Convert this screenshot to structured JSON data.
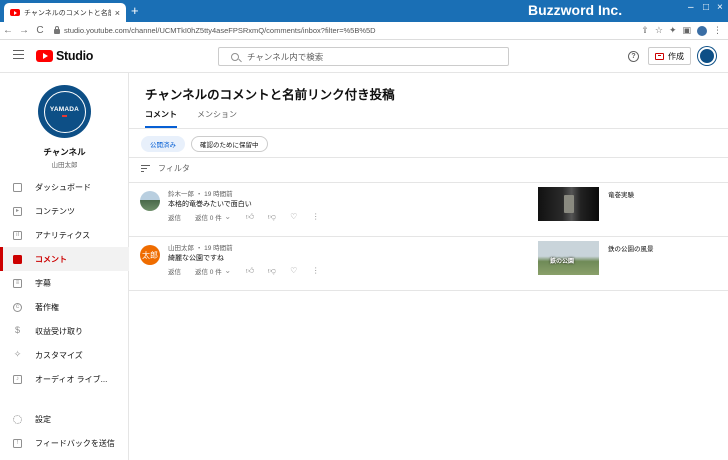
{
  "browser": {
    "tab_title": "チャンネルのコメントと名前リンク付き",
    "new_tab": "+",
    "url": "studio.youtube.com/channel/UCMTkI0hZ5tty4aseFPSRxmQ/comments/inbox?filter=%5B%5D",
    "brand": "Buzzword Inc.",
    "back": "←",
    "forward": "→",
    "reload": "C"
  },
  "header": {
    "logo_text": "Studio",
    "search_placeholder": "チャンネル内で検索",
    "help": "?",
    "create_label": "作成"
  },
  "channel": {
    "avatar_text": "YAMADA",
    "title": "チャンネル",
    "name": "山田太郎"
  },
  "nav": {
    "items": [
      {
        "label": "ダッシュボード",
        "icon": "dashboard-icon"
      },
      {
        "label": "コンテンツ",
        "icon": "content-icon"
      },
      {
        "label": "アナリティクス",
        "icon": "analytics-icon"
      },
      {
        "label": "コメント",
        "icon": "comment-icon"
      },
      {
        "label": "字幕",
        "icon": "subtitles-icon"
      },
      {
        "label": "著作権",
        "icon": "copyright-icon"
      },
      {
        "label": "収益受け取り",
        "icon": "monetization-icon"
      },
      {
        "label": "カスタマイズ",
        "icon": "customize-icon"
      },
      {
        "label": "オーディオ ライブ...",
        "icon": "audio-library-icon"
      }
    ],
    "bottom": [
      {
        "label": "設定",
        "icon": "settings-icon"
      },
      {
        "label": "フィードバックを送信",
        "icon": "feedback-icon"
      }
    ]
  },
  "main": {
    "title": "チャンネルのコメントと名前リンク付き投稿",
    "tabs": [
      "コメント",
      "メンション"
    ],
    "chips": [
      "公開済み",
      "確認のために保留中"
    ],
    "filter_label": "フィルタ",
    "comments": [
      {
        "author": "鈴木一郎",
        "time": "19 時間前",
        "text": "本格的竜巻みたいで面白い",
        "reply": "返信",
        "replies": "返信 0 件",
        "video_title": "竜巻実験"
      },
      {
        "author": "山田太郎",
        "avatar_letter": "太郎",
        "time": "19 時間前",
        "text": "綺麗な公園ですね",
        "reply": "返信",
        "replies": "返信 0 件",
        "video_title": "鉄の公園の風景",
        "thumb_overlay": "鉄の公園"
      }
    ]
  }
}
